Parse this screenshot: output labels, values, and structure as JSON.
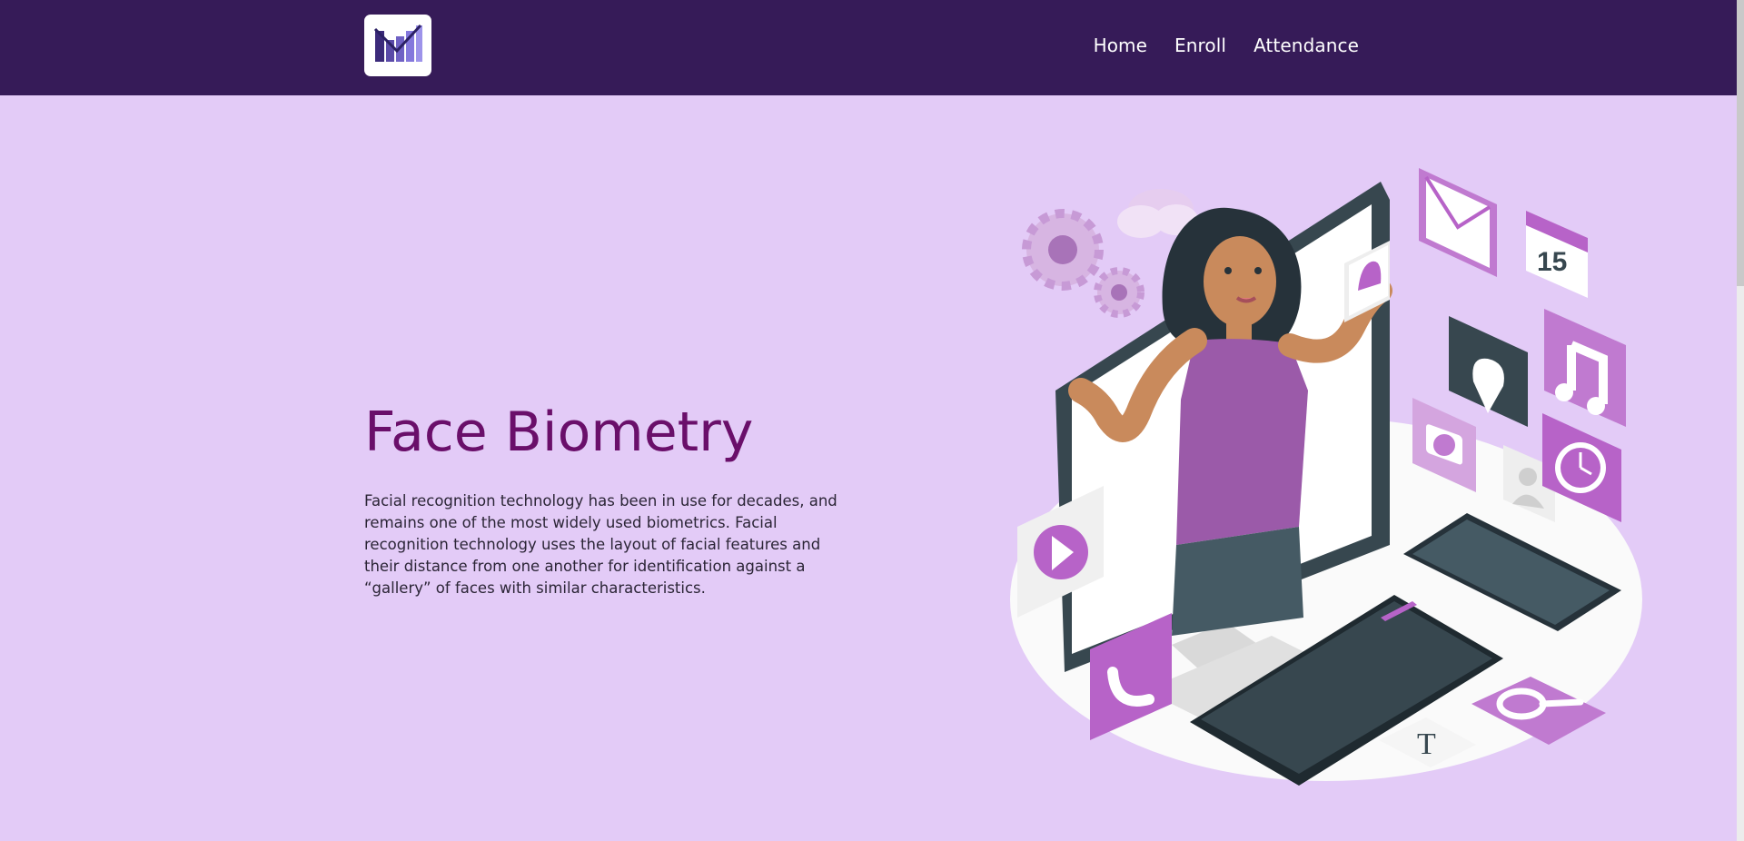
{
  "nav": {
    "links": [
      "Home",
      "Enroll",
      "Attendance"
    ]
  },
  "hero": {
    "title": "Face Biometry",
    "description": "Facial recognition technology has been in use for decades, and remains one of the most widely used biometrics. Facial recognition technology uses the layout of facial features and their distance from one another for identification against a “gallery” of faces with similar characteristics."
  },
  "illustration": {
    "calendar_day": "15",
    "key_letter": "T"
  },
  "colors": {
    "navbar": "#361b58",
    "background": "#e3cbf7",
    "title": "#6a0f6a",
    "accent": "#b763c8"
  }
}
